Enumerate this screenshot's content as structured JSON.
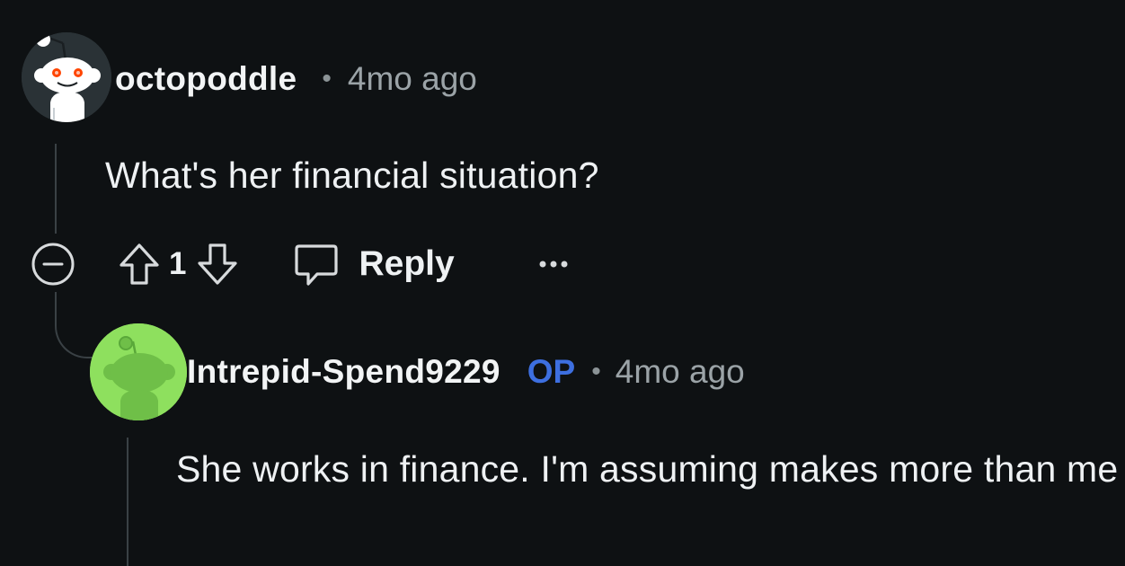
{
  "comments": [
    {
      "username": "octopoddle",
      "separator": "•",
      "time": "4mo ago",
      "body": "What's her financial situation?",
      "avatar_icon": "snoo-avatar-icon"
    },
    {
      "username": "Intrepid-Spend9229",
      "badge": "OP",
      "separator": "•",
      "time": "4mo ago",
      "body": "She works in finance. I'm assuming makes more than me",
      "avatar_icon": "snoo-avatar-icon"
    }
  ],
  "actions": {
    "score": "1",
    "reply_label": "Reply",
    "collapse_icon": "collapse-minus-icon",
    "upvote_icon": "upvote-arrow-icon",
    "downvote_icon": "downvote-arrow-icon",
    "reply_icon": "speech-bubble-icon",
    "more_icon": "ellipsis-icon"
  },
  "colors": {
    "background": "#0e1113",
    "op_badge": "#3d6fe0",
    "avatar_2_bg": "#8ee05e"
  }
}
